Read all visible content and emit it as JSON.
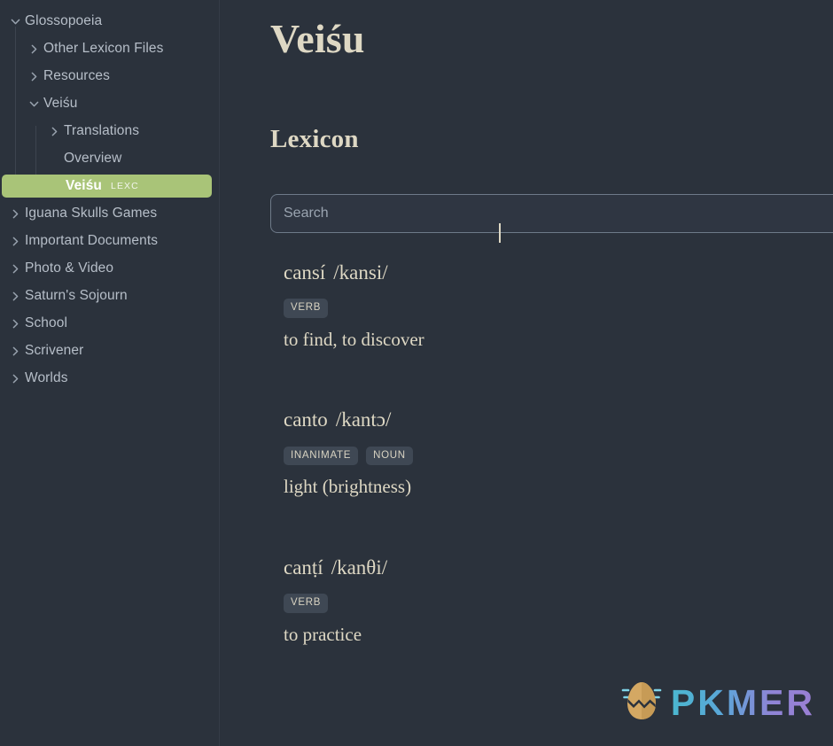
{
  "sidebar": {
    "items": [
      {
        "label": "Glossopoeia",
        "level": 0,
        "icon": "chevron-down-icon",
        "state": "expanded",
        "selected": false
      },
      {
        "label": "Other Lexicon Files",
        "level": 1,
        "icon": "chevron-right-icon",
        "state": "collapsed",
        "selected": false
      },
      {
        "label": "Resources",
        "level": 1,
        "icon": "chevron-right-icon",
        "state": "collapsed",
        "selected": false
      },
      {
        "label": "Veiśu",
        "level": 1,
        "icon": "chevron-down-icon",
        "state": "expanded",
        "selected": false
      },
      {
        "label": "Translations",
        "level": 2,
        "icon": "chevron-right-icon",
        "state": "collapsed",
        "selected": false
      },
      {
        "label": "Overview",
        "level": 2,
        "icon": "none",
        "state": "leaf",
        "selected": false
      },
      {
        "label": "Veiśu",
        "level": 2,
        "icon": "none",
        "state": "leaf",
        "selected": true,
        "badge": "LEXC"
      },
      {
        "label": "Iguana Skulls Games",
        "level": 0,
        "icon": "chevron-right-icon",
        "state": "collapsed",
        "selected": false
      },
      {
        "label": "Important Documents",
        "level": 0,
        "icon": "chevron-right-icon",
        "state": "collapsed",
        "selected": false
      },
      {
        "label": "Photo & Video",
        "level": 0,
        "icon": "chevron-right-icon",
        "state": "collapsed",
        "selected": false
      },
      {
        "label": "Saturn's Sojourn",
        "level": 0,
        "icon": "chevron-right-icon",
        "state": "collapsed",
        "selected": false
      },
      {
        "label": "School",
        "level": 0,
        "icon": "chevron-right-icon",
        "state": "collapsed",
        "selected": false
      },
      {
        "label": "Scrivener",
        "level": 0,
        "icon": "chevron-right-icon",
        "state": "collapsed",
        "selected": false
      },
      {
        "label": "Worlds",
        "level": 0,
        "icon": "chevron-right-icon",
        "state": "collapsed",
        "selected": false
      }
    ]
  },
  "main": {
    "title": "Veiśu",
    "section_heading": "Lexicon",
    "search": {
      "value": "",
      "placeholder": "Search",
      "focused": true
    },
    "entries": [
      {
        "headword": "cansí",
        "pronunciation": "/kansi/",
        "tags": [
          "VERB"
        ],
        "definition": "to find, to discover"
      },
      {
        "headword": "canto",
        "pronunciation": "/kantɔ/",
        "tags": [
          "INANIMATE",
          "NOUN"
        ],
        "definition": "light (brightness)"
      },
      {
        "headword": "canṭí",
        "pronunciation": "/kanθi/",
        "tags": [
          "VERB"
        ],
        "definition": "to practice"
      }
    ]
  },
  "watermark": {
    "text": "PKMER",
    "icon": "cracked-egg-icon"
  },
  "colors": {
    "background": "#2b323c",
    "sidebar_text": "#b6bec8",
    "accent_selected": "#a9c478",
    "serif_cream": "#ded8c4",
    "tag_background": "#3f4854",
    "search_border": "#6e7a89"
  }
}
